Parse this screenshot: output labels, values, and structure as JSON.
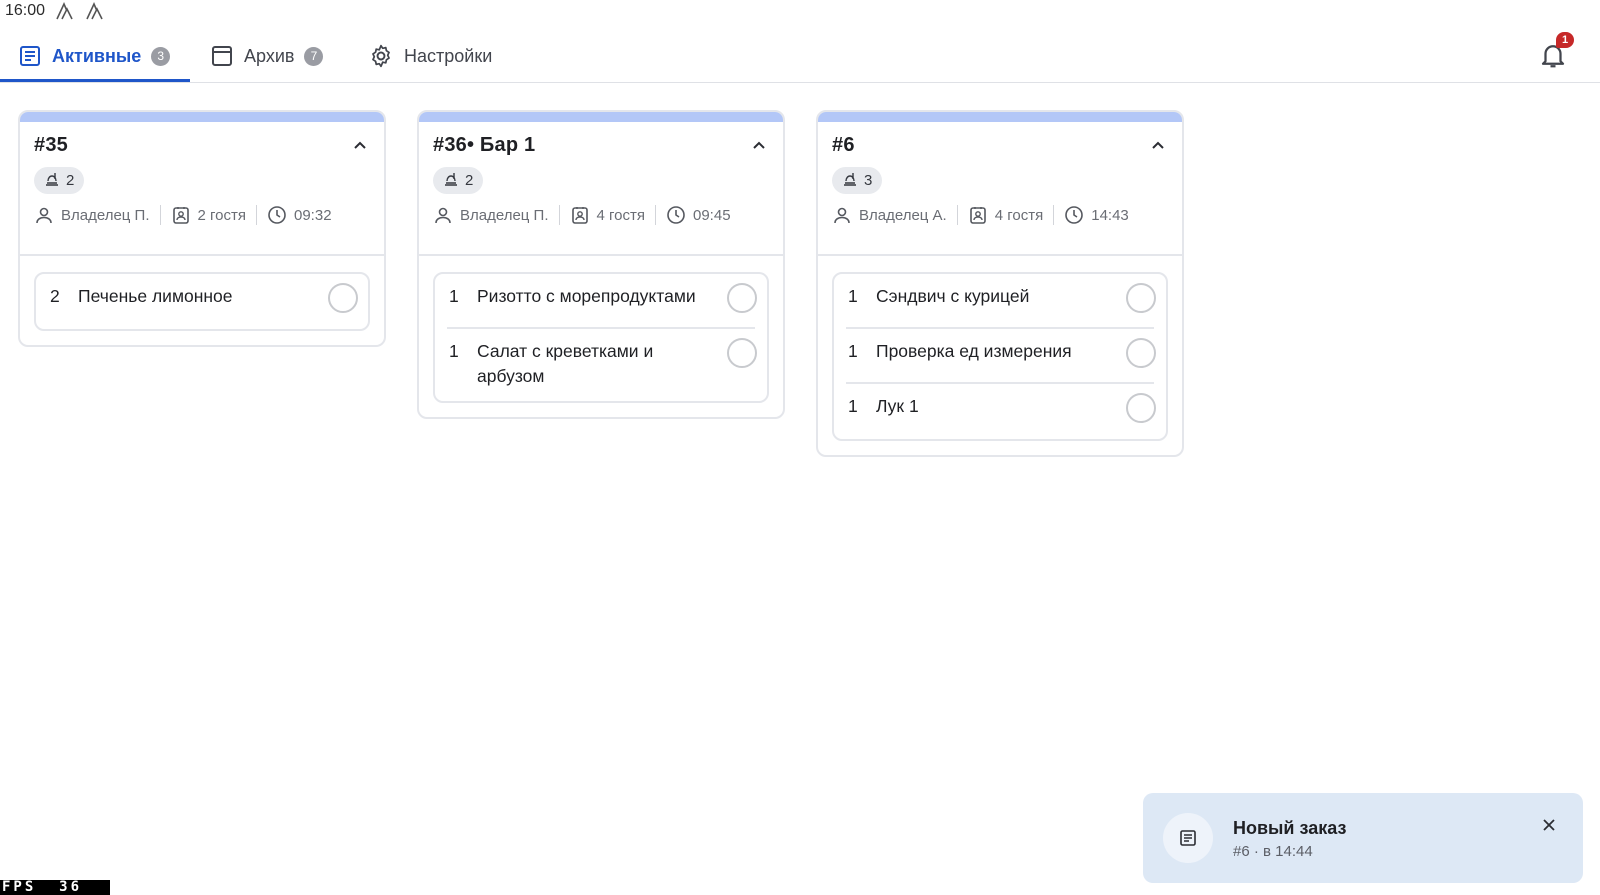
{
  "status_bar": {
    "time": "16:00",
    "icons": [
      "a-icon",
      "a-icon"
    ]
  },
  "tabs": [
    {
      "label": "Активные",
      "count": "3",
      "icon": "orders-list-icon",
      "active": true
    },
    {
      "label": "Архив",
      "count": "7",
      "icon": "archive-icon",
      "active": false
    },
    {
      "label": "Настройки",
      "icon": "gear-icon",
      "active": false
    }
  ],
  "notifications": {
    "icon": "bell-icon",
    "count": "1"
  },
  "orders": [
    {
      "title": "#35",
      "positions": "2",
      "waiter": "Владелец П.",
      "guests": "2 гостя",
      "time": "09:32",
      "items": [
        {
          "qty": "2",
          "name": "Печенье лимонное"
        }
      ]
    },
    {
      "title": "#36• Бар 1",
      "positions": "2",
      "waiter": "Владелец П.",
      "guests": "4 гостя",
      "time": "09:45",
      "items": [
        {
          "qty": "1",
          "name": "Ризотто с морепродуктами"
        },
        {
          "qty": "1",
          "name": "Салат с креветками и арбузом"
        }
      ]
    },
    {
      "title": "#6",
      "positions": "3",
      "waiter": "Владелец А.",
      "guests": "4 гостя",
      "time": "14:43",
      "items": [
        {
          "qty": "1",
          "name": "Сэндвич с курицей"
        },
        {
          "qty": "1",
          "name": "Проверка ед измерения"
        },
        {
          "qty": "1",
          "name": "Лук 1"
        }
      ]
    }
  ],
  "toast": {
    "title": "Новый заказ",
    "subtitle": "#6  · в 14:44",
    "icon": "order-icon"
  },
  "fps": "FPS  36",
  "colors": {
    "accent": "#1f56c9",
    "card_top": "#b3c7f7",
    "toast_bg": "#dde8f5",
    "badge_red": "#c62828"
  }
}
